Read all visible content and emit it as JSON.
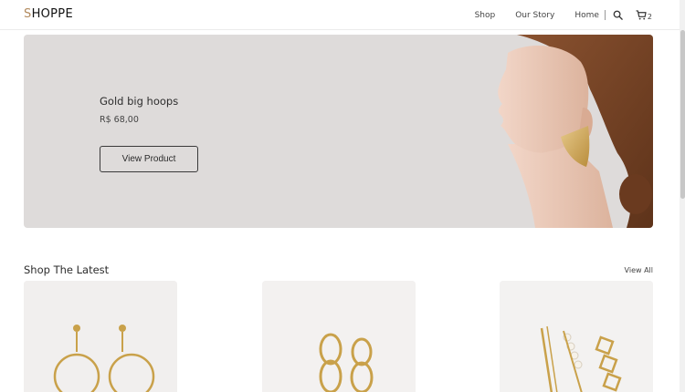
{
  "header": {
    "logo_first": "S",
    "logo_rest": "HOPPE",
    "nav": [
      "Shop",
      "Our Story",
      "Home"
    ],
    "cart_count": "2",
    "icons": [
      "search-icon",
      "cart-icon"
    ]
  },
  "hero": {
    "title": "Gold big hoops",
    "price": "R$ 68,00",
    "button_label": "View Product"
  },
  "latest": {
    "title": "Shop The Latest",
    "view_all": "View All",
    "products": [
      "gold-circle-drop-earrings",
      "gold-chain-link-earrings",
      "pearl-hair-clips"
    ]
  },
  "colors": {
    "accent": "#b28a5e",
    "hero_bg": "#dedbda",
    "gold": "#c9a14a"
  }
}
